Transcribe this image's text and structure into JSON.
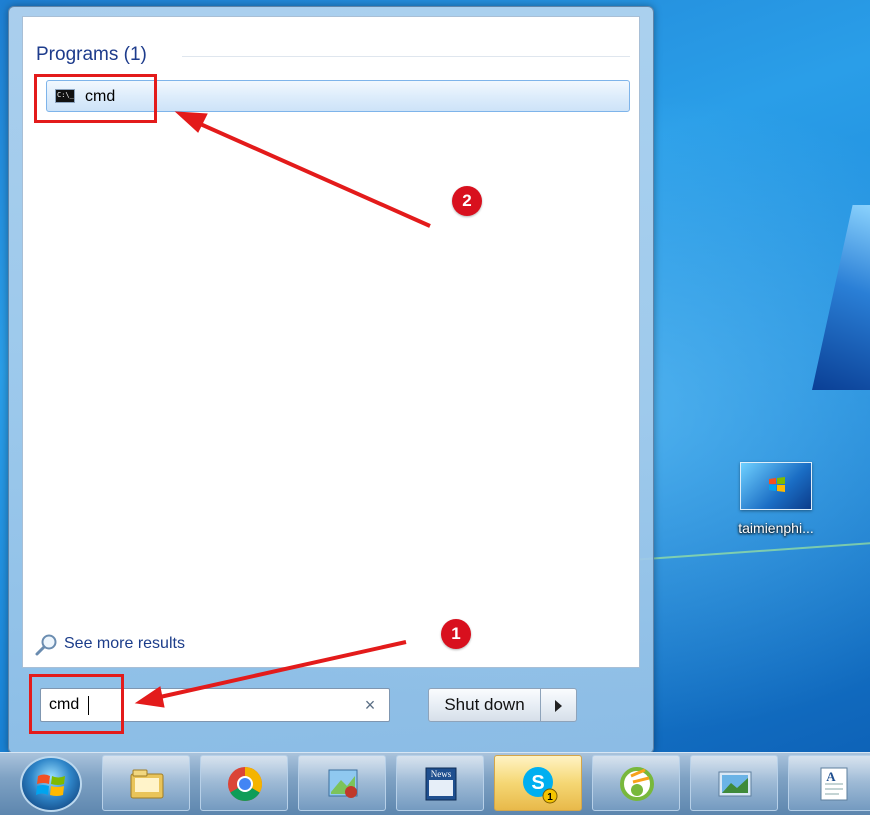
{
  "start_menu": {
    "programs_header": "Programs (1)",
    "results": [
      {
        "label": "cmd",
        "icon": "command-prompt-icon"
      }
    ],
    "see_more": "See more results",
    "search": {
      "value": "cmd",
      "clear_symbol": "×"
    },
    "shutdown_label": "Shut down"
  },
  "annotations": {
    "step1": "1",
    "step2": "2",
    "color": "#e31b1b"
  },
  "desktop": {
    "icon_label": "taimienphi..."
  },
  "taskbar": {
    "buttons": [
      {
        "icon": "file-explorer-icon"
      },
      {
        "icon": "chrome-icon"
      },
      {
        "icon": "paint-icon"
      },
      {
        "icon": "news-icon"
      },
      {
        "icon": "skype-icon",
        "badge": "1",
        "active": true
      },
      {
        "icon": "coccoc-icon"
      },
      {
        "icon": "picture-viewer-icon"
      },
      {
        "icon": "wordpad-icon"
      }
    ]
  }
}
